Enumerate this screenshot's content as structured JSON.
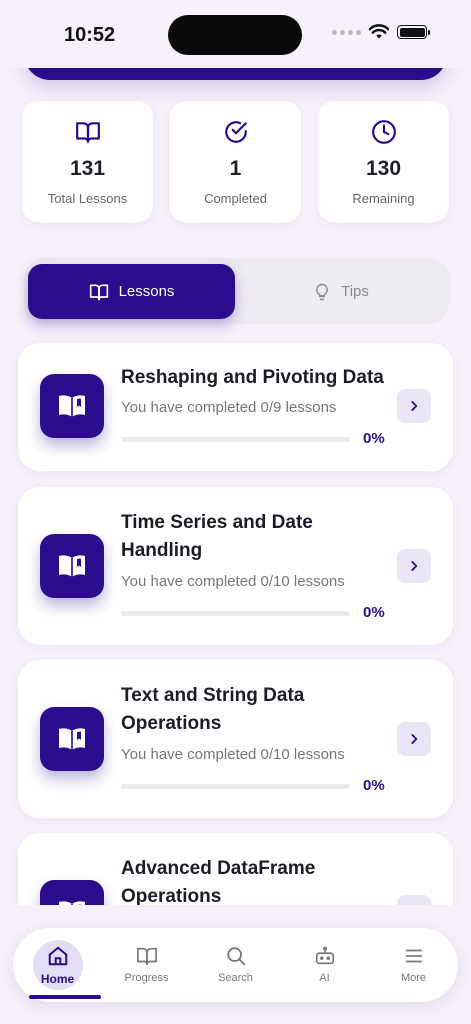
{
  "status": {
    "time": "10:52"
  },
  "stats": [
    {
      "value": "131",
      "label": "Total Lessons",
      "icon": "book-icon"
    },
    {
      "value": "1",
      "label": "Completed",
      "icon": "check-circle-icon"
    },
    {
      "value": "130",
      "label": "Remaining",
      "icon": "clock-icon"
    }
  ],
  "tabs": {
    "lessons": "Lessons",
    "tips": "Tips",
    "active": "Lessons"
  },
  "lessons": [
    {
      "title": "Reshaping and Pivoting Data",
      "subtitle": "You have completed 0/9 lessons",
      "percent": "0%",
      "progress": 0
    },
    {
      "title": "Time Series and Date Handling",
      "subtitle": "You have completed 0/10 lessons",
      "percent": "0%",
      "progress": 0
    },
    {
      "title": "Text and String Data Operations",
      "subtitle": "You have completed 0/10 lessons",
      "percent": "0%",
      "progress": 0
    },
    {
      "title": "Advanced DataFrame Operations",
      "subtitle": "",
      "percent": "",
      "progress": 0
    }
  ],
  "nav": [
    {
      "label": "Home",
      "icon": "home-icon",
      "active": true
    },
    {
      "label": "Progress",
      "icon": "book-icon",
      "active": false
    },
    {
      "label": "Search",
      "icon": "search-icon",
      "active": false
    },
    {
      "label": "AI",
      "icon": "robot-icon",
      "active": false
    },
    {
      "label": "More",
      "icon": "menu-icon",
      "active": false
    }
  ],
  "colors": {
    "accent": "#2a0c8c",
    "background": "#f7f1fb",
    "card": "#ffffff"
  }
}
